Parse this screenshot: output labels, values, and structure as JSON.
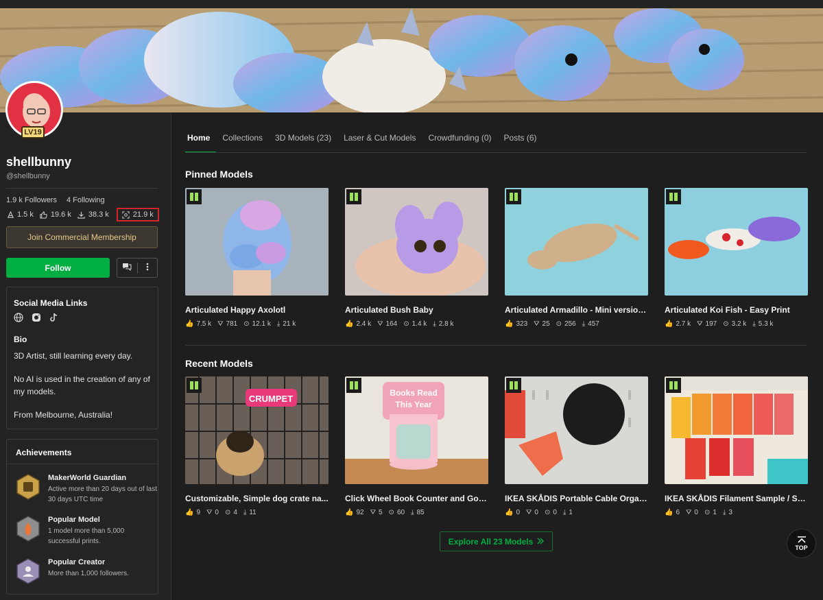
{
  "profile": {
    "username": "shellbunny",
    "handle": "@shellbunny",
    "level": "LV19",
    "followers": "1.9 k Followers",
    "following": "4 Following",
    "stats": {
      "prints": "1.5 k",
      "likes": "19.6 k",
      "downloads": "38.3 k",
      "boosts": "21.9 k"
    },
    "membership_label": "Join Commercial Membership",
    "follow_label": "Follow"
  },
  "about": {
    "social_title": "Social Media Links",
    "social_icons": [
      "globe-icon",
      "instagram-icon",
      "tiktok-icon"
    ],
    "bio_title": "Bio",
    "bio_lines": [
      "3D Artist, still learning every day.",
      "No AI is used in the creation of any of my models.",
      "From Melbourne, Australia!"
    ]
  },
  "achievements": {
    "title": "Achievements",
    "items": [
      {
        "title": "MakerWorld Guardian",
        "desc": "Active more than 20 days out of last 30 days UTC time",
        "color": "#c9a24a"
      },
      {
        "title": "Popular Model",
        "desc": "1 model more than 5,000 successful prints.",
        "color": "#8e8e8e"
      },
      {
        "title": "Popular Creator",
        "desc": "More than 1,000 followers.",
        "color": "#9c8fb5"
      }
    ]
  },
  "tabs": [
    "Home",
    "Collections",
    "3D Models (23)",
    "Laser & Cut Models",
    "Crowdfunding (0)",
    "Posts (6)"
  ],
  "pinned": {
    "title": "Pinned Models",
    "items": [
      {
        "title": "Articulated Happy Axolotl",
        "likes": "7.5 k",
        "prints": "781",
        "boosts": "12.1 k",
        "downloads": "21 k"
      },
      {
        "title": "Articulated Bush Baby",
        "likes": "2.4 k",
        "prints": "164",
        "boosts": "1.4 k",
        "downloads": "2.8 k"
      },
      {
        "title": "Articulated Armadillo - Mini version ...",
        "likes": "323",
        "prints": "25",
        "boosts": "256",
        "downloads": "457"
      },
      {
        "title": "Articulated Koi Fish - Easy Print",
        "likes": "2.7 k",
        "prints": "197",
        "boosts": "3.2 k",
        "downloads": "5.3 k"
      }
    ]
  },
  "recent": {
    "title": "Recent Models",
    "items": [
      {
        "title": "Customizable, Simple dog crate na...",
        "likes": "9",
        "prints": "0",
        "boosts": "4",
        "downloads": "11"
      },
      {
        "title": "Click Wheel Book Counter and Goal ...",
        "likes": "92",
        "prints": "5",
        "boosts": "60",
        "downloads": "85"
      },
      {
        "title": "IKEA SKÅDIS Portable Cable Organiz...",
        "likes": "0",
        "prints": "0",
        "boosts": "0",
        "downloads": "1"
      },
      {
        "title": "IKEA SKÅDIS Filament Sample / Swat...",
        "likes": "6",
        "prints": "0",
        "boosts": "1",
        "downloads": "3"
      }
    ]
  },
  "thumb_text": {
    "crumpet": "CRUMPET",
    "books_read": "Books Read",
    "this_year": "This Year"
  },
  "explore_label": "Explore All 23 Models",
  "top_label": "TOP",
  "colors": {
    "accent": "#00ae42",
    "highlight": "#d3232b"
  }
}
